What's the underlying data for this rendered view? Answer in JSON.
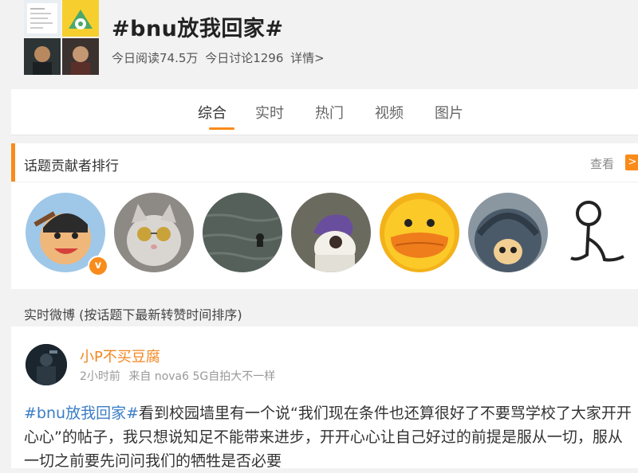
{
  "topic": {
    "title": "#bnu放我回家#",
    "read_label": "今日阅读74.5万",
    "discuss_label": "今日讨论1296",
    "details_link": "详情>"
  },
  "tabs": [
    {
      "label": "综合",
      "active": true
    },
    {
      "label": "实时",
      "active": false
    },
    {
      "label": "热门",
      "active": false
    },
    {
      "label": "视频",
      "active": false
    },
    {
      "label": "图片",
      "active": false
    }
  ],
  "contributors": {
    "heading": "话题贡献者排行",
    "view_label": "查看",
    "arrow": ">",
    "verified_badge": "v",
    "avatars": [
      "cartoon-character-avatar",
      "cat-sunglasses-avatar",
      "sea-swimmer-avatar",
      "anime-character-avatar",
      "yellow-duck-avatar",
      "helmet-character-avatar",
      "stick-figure-avatar"
    ]
  },
  "feed": {
    "section_label": "实时微博 (按话题下最新转赞时间排序)",
    "posts": [
      {
        "username": "小P不买豆腐",
        "time": "2小时前",
        "source": "来自 nova6 5G自拍大不一样",
        "tag": "#bnu放我回家#",
        "text": "看到校园墙里有一个说“我们现在条件也还算很好了不要骂学校了大家开开心心”的帖子，我只想说知足不能带来进步，开开心心让自己好过的前提是服从一切，服从一切之前要先问问我们的牺牲是否必要"
      }
    ]
  },
  "colors": {
    "accent": "#f98b1b",
    "username": "#f3861f",
    "hashtag": "#3a7ec6"
  }
}
